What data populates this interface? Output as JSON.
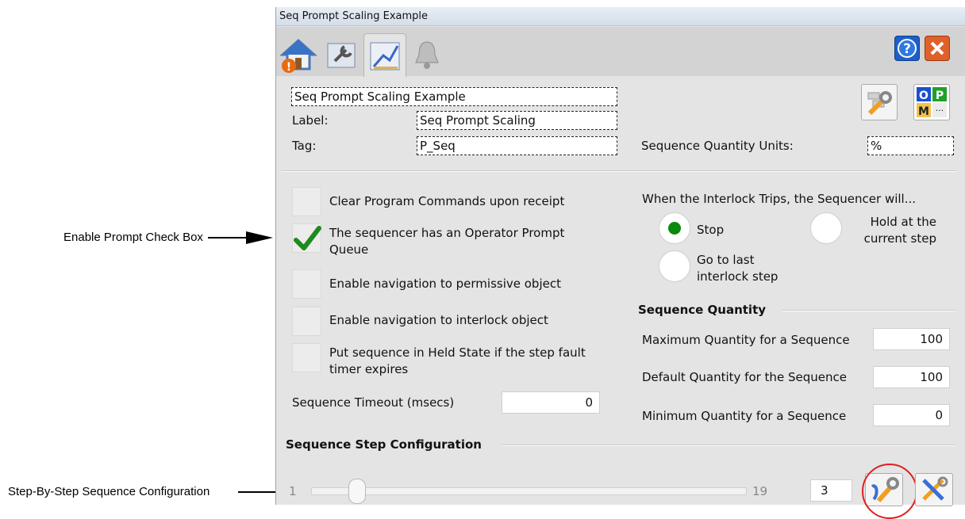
{
  "annotations": {
    "prompt_checkbox": "Enable Prompt Check Box",
    "step_config": "Step-By-Step Sequence Configuration"
  },
  "window": {
    "title": "Seq Prompt Scaling Example"
  },
  "header": {
    "description": "Seq Prompt Scaling Example",
    "label_caption": "Label:",
    "label_value": "Seq Prompt Scaling",
    "tag_caption": "Tag:",
    "tag_value": "P_Seq",
    "units_caption": "Sequence Quantity Units:",
    "units_value": "%",
    "opm": [
      "O",
      "P",
      "M",
      "···"
    ]
  },
  "options": [
    {
      "text": "Clear Program Commands upon receipt",
      "checked": false
    },
    {
      "text": "The sequencer has an Operator Prompt Queue",
      "checked": true
    },
    {
      "text": "Enable navigation to permissive object",
      "checked": false
    },
    {
      "text": "Enable navigation to interlock object",
      "checked": false
    },
    {
      "text": "Put sequence in Held State if the step fault timer expires",
      "checked": false
    }
  ],
  "timeout": {
    "label": "Sequence Timeout (msecs)",
    "value": "0"
  },
  "interlock": {
    "title": "When the Interlock Trips, the Sequencer will...",
    "stop": "Stop",
    "hold": "Hold at the current step",
    "goto": "Go to last interlock step",
    "selected": "stop"
  },
  "quantity": {
    "title": "Sequence Quantity",
    "max_label": "Maximum Quantity for a Sequence",
    "max_value": "100",
    "def_label": "Default Quantity for the Sequence",
    "def_value": "100",
    "min_label": "Minimum Quantity for a Sequence",
    "min_value": "0"
  },
  "steps": {
    "title": "Sequence Step Configuration",
    "min": "1",
    "max": "19",
    "value": "3"
  },
  "colors": {
    "check": "#1e8b1e",
    "radio": "#0a8a0a",
    "highlight": "#e02020"
  }
}
